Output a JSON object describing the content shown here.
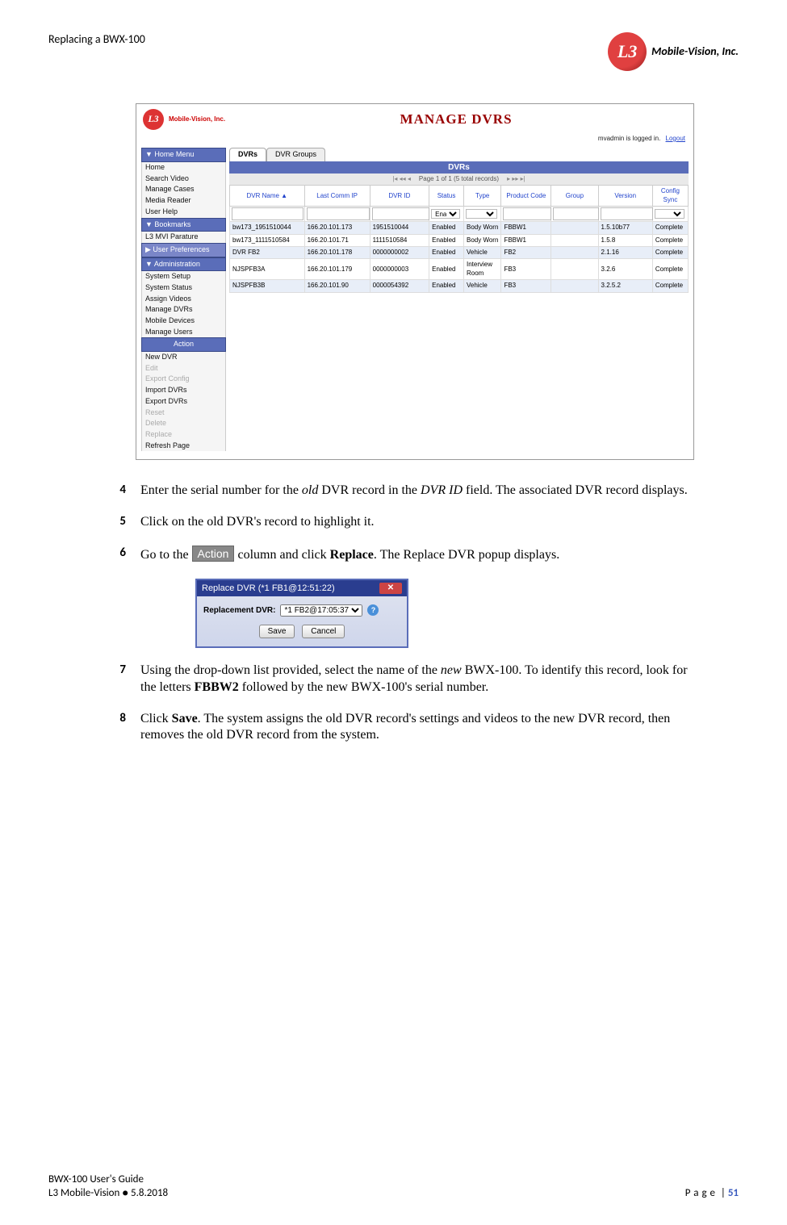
{
  "header": {
    "left": "Replacing a BWX-100",
    "logo_text": "Mobile-Vision, Inc.",
    "logo_mark": "L3"
  },
  "screenshot": {
    "title": "MANAGE DVRS",
    "brand": "Mobile-Vision, Inc.",
    "login_text": "mvadmin is logged in.",
    "logout": "Logout",
    "side": {
      "home_menu": "▼  Home Menu",
      "home_items": [
        "Home",
        "Search Video",
        "Manage Cases",
        "Media Reader",
        "User Help"
      ],
      "bookmarks": "▼  Bookmarks",
      "bm_items": [
        "L3 MVI Parature"
      ],
      "user_prefs": "▶  User Preferences",
      "admin": "▼  Administration",
      "admin_items": [
        "System Setup",
        "System Status",
        "Assign Videos",
        "Manage DVRs",
        "Mobile Devices",
        "Manage Users"
      ],
      "action": "Action",
      "action_items": [
        "New DVR",
        "Edit",
        "Export Config",
        "Import DVRs",
        "Export DVRs",
        "Reset",
        "Delete",
        "Replace",
        "Refresh Page"
      ],
      "dim": [
        "Edit",
        "Export Config",
        "Reset",
        "Delete",
        "Replace"
      ]
    },
    "tabs": [
      "DVRs",
      "DVR Groups"
    ],
    "grid_title": "DVRs",
    "pager": "Page 1 of 1 (5 total records)",
    "columns": [
      "DVR Name  ▲",
      "Last Comm IP",
      "DVR ID",
      "Status",
      "Type",
      "Product Code",
      "Group",
      "Version",
      "Config Sync"
    ],
    "filter_status": "Enabled",
    "rows": [
      [
        "bw173_1951510044",
        "166.20.101.173",
        "1951510044",
        "Enabled",
        "Body Worn",
        "FBBW1",
        "",
        "1.5.10b77",
        "Complete"
      ],
      [
        "bw173_1111510584",
        "166.20.101.71",
        "1111510584",
        "Enabled",
        "Body Worn",
        "FBBW1",
        "",
        "1.5.8",
        "Complete"
      ],
      [
        "DVR FB2",
        "166.20.101.178",
        "0000000002",
        "Enabled",
        "Vehicle",
        "FB2",
        "",
        "2.1.16",
        "Complete"
      ],
      [
        "NJSPFB3A",
        "166.20.101.179",
        "0000000003",
        "Enabled",
        "Interview Room",
        "FB3",
        "",
        "3.2.6",
        "Complete"
      ],
      [
        "NJSPFB3B",
        "166.20.101.90",
        "0000054392",
        "Enabled",
        "Vehicle",
        "FB3",
        "",
        "3.2.5.2",
        "Complete"
      ]
    ]
  },
  "steps": {
    "s4_num": "4",
    "s4_a": "Enter the serial number for the ",
    "s4_b": "old",
    "s4_c": " DVR record in the ",
    "s4_d": "DVR ID",
    "s4_e": " field. The associated DVR record displays.",
    "s5_num": "5",
    "s5": "Click on the old DVR's record to highlight it.",
    "s6_num": "6",
    "s6_a": "Go to the ",
    "s6_chip": "Action",
    "s6_b": " column and click ",
    "s6_c": "Replace",
    "s6_d": ". The Replace DVR popup displays.",
    "s7_num": "7",
    "s7_a": "Using the drop-down list provided, select the name of the ",
    "s7_b": "new",
    "s7_c": " BWX-100. To identify this record, look for the letters ",
    "s7_d": "FBBW2",
    "s7_e": " followed by the new BWX-100's serial number.",
    "s8_num": "8",
    "s8_a": "Click ",
    "s8_b": "Save",
    "s8_c": ". The system assigns the old DVR record's settings and videos to the new DVR record, then removes the old DVR record from the system."
  },
  "popup": {
    "title": "Replace DVR (*1 FB1@12:51:22)",
    "label": "Replacement DVR:",
    "option": "*1 FB2@17:05:37",
    "save": "Save",
    "cancel": "Cancel",
    "close": "✕"
  },
  "footer": {
    "line1": "BWX-100 User's Guide",
    "line2": "L3 Mobile-Vision ● 5.8.2018",
    "page_label": "Page",
    "sep": " | ",
    "page_num": "51"
  }
}
